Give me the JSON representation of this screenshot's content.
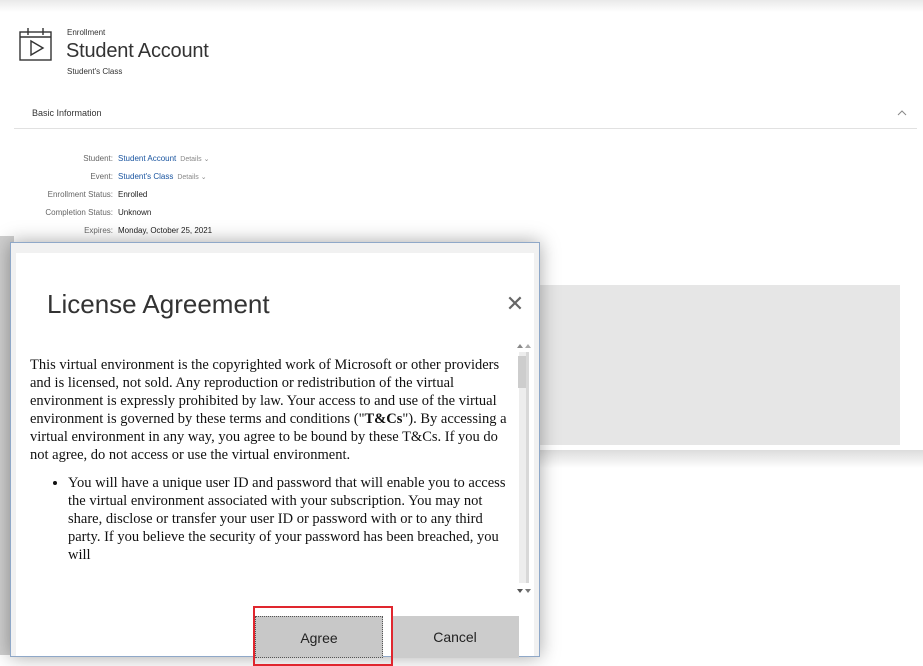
{
  "header": {
    "breadcrumb": "Enrollment",
    "title": "Student Account",
    "subtitle": "Student's Class",
    "icon": "calendar-play-icon"
  },
  "section": {
    "title": "Basic Information",
    "toggle_icon": "chevron-up-icon"
  },
  "info": [
    {
      "label": "Student:",
      "value": "Student Account",
      "details": "Details"
    },
    {
      "label": "Event:",
      "value": "Student's Class",
      "details": "Details"
    },
    {
      "label": "Enrollment Status:",
      "value": "Enrolled"
    },
    {
      "label": "Completion Status:",
      "value": "Unknown"
    },
    {
      "label": "Expires:",
      "value": "Monday, October 25, 2021"
    }
  ],
  "dialog": {
    "title": "License Agreement",
    "close_icon": "close-icon",
    "paragraph": {
      "before": "This virtual environment is the copyrighted work of Microsoft or other providers and is licensed, not sold. Any reproduction or redistribution of the virtual environment is expressly prohibited by law. Your access to and use of the virtual environment is governed by these terms and conditions (\"",
      "bold": "T&Cs",
      "after": "\"). By accessing a virtual environment in any way, you agree to be bound by these T&Cs. If you do not agree, do not access or use the virtual environment."
    },
    "bullet_1": "You will have a unique user ID and password that will enable you to access the virtual environment associated with your subscription. You may not share, disclose or transfer your user ID or password with or to any third party. If you believe the security of your password has been breached, you will",
    "agree_label": "Agree",
    "cancel_label": "Cancel",
    "highlight_color": "#e0262e"
  }
}
